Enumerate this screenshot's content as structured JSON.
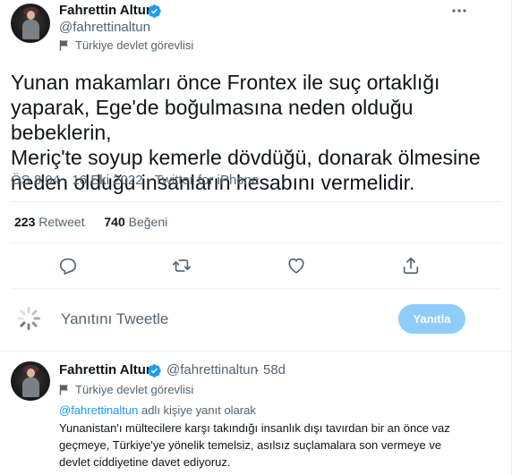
{
  "author": {
    "name": "Fahrettin Altun",
    "handle": "@fahrettinaltun",
    "label": "Türkiye devlet görevlisi"
  },
  "tweet": {
    "text": "Yunan makamları önce Frontex ile suç ortaklığı\nyaparak, Ege'de boğulmasına neden olduğu bebeklerin,\nMeriç'te soyup kemerle dövdüğü, donarak ölmesine\nneden olduğu insanların hesabını vermelidir.",
    "meta": "ÖS 8:04 · 16 Eki 2022 · Twitter for iPhone"
  },
  "stats": {
    "retweet_count": "223",
    "retweet_label": "Retweet",
    "like_count": "740",
    "like_label": "Beğeni"
  },
  "actions": {
    "icons": [
      "reply-icon",
      "retweet-icon",
      "like-icon",
      "share-icon"
    ]
  },
  "composer": {
    "placeholder": "Yanıtını Tweetle",
    "button_label": "Yanıtla"
  },
  "reply": {
    "name": "Fahrettin Altun",
    "handle": "@fahrettinaltun",
    "dot": "·",
    "time": "58d",
    "label": "Türkiye devlet görevlisi",
    "replying_mention": "@fahrettinaltun",
    "replying_suffix": " adlı kişiye yanıt olarak",
    "text": "Yunanistan'ı mültecilere karşı takındığı insanlık dışı tavırdan bir an önce vaz\ngeçmeye, Türkiye'ye yönelik temelsiz, asılsız suçlamalara son vermeye ve\ndevlet ciddiyetine davet ediyoruz."
  },
  "colors": {
    "accent": "#1d9bf0",
    "accent_disabled": "#8ecdf8",
    "secondary_text": "#536471",
    "border": "#eff3f4"
  }
}
